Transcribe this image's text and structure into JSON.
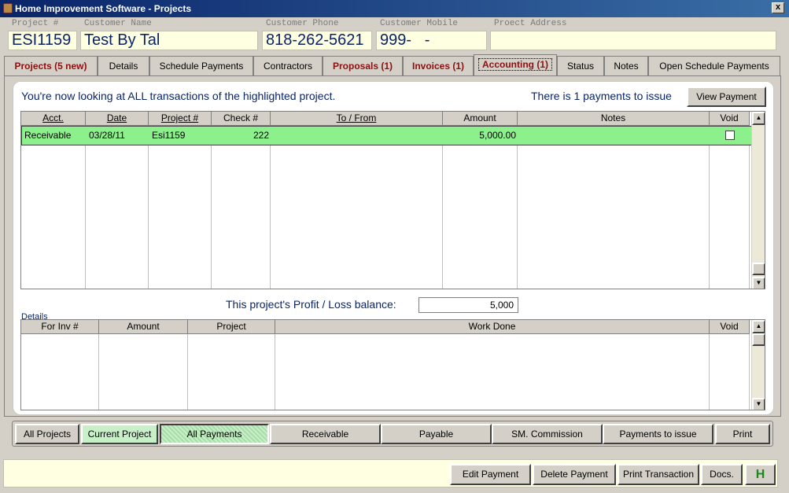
{
  "window": {
    "title": "Home Improvement Software - Projects",
    "close_glyph": "x"
  },
  "header": {
    "project_num": {
      "label": "Project #",
      "value": "ESI1159"
    },
    "customer_name": {
      "label": "Customer Name",
      "value": "Test By Tal"
    },
    "customer_phone": {
      "label": "Customer Phone",
      "value": "818-262-5621"
    },
    "customer_mobile": {
      "label": "Customer Mobile",
      "value": "999-   -"
    },
    "project_address": {
      "label": "Proect Address",
      "value": ""
    }
  },
  "tabs": [
    {
      "label": "Projects (5 new)"
    },
    {
      "label": "Details"
    },
    {
      "label": "Schedule Payments"
    },
    {
      "label": "Contractors"
    },
    {
      "label": "Proposals (1)"
    },
    {
      "label": "Invoices (1)"
    },
    {
      "label": "Accounting (1)"
    },
    {
      "label": "Status"
    },
    {
      "label": "Notes"
    },
    {
      "label": "Open Schedule Payments"
    }
  ],
  "accounting": {
    "headline": "You're now looking at ALL transactions of the highlighted project.",
    "issue_text": "There is 1 payments to issue",
    "view_payment_label": "View Payment",
    "transactions": {
      "columns": [
        "Acct.",
        "Date",
        "Project #",
        "Check #",
        "To / From",
        "Amount",
        "Notes",
        "Void"
      ],
      "rows": [
        {
          "acct": "Receivable",
          "date": "03/28/11",
          "project": "Esi1159",
          "check": "222",
          "to_from": "",
          "amount": "5,000.00",
          "notes": "",
          "void": false
        }
      ]
    },
    "balance_label": "This project's Profit / Loss balance:",
    "balance_value": "5,000",
    "details_label": "Details",
    "details": {
      "columns": [
        "For Inv #",
        "Amount",
        "Project",
        "Work Done",
        "Void"
      ],
      "rows": []
    }
  },
  "filter_buttons": {
    "all_projects": "All Projects",
    "current_project": "Current Project",
    "all_payments": "All Payments",
    "receivable": "Receivable",
    "payable": "Payable",
    "sm_commission": "SM. Commission",
    "payments_to_issue": "Payments to issue",
    "print": "Print"
  },
  "status_buttons": {
    "edit_payment": "Edit Payment",
    "delete_payment": "Delete Payment",
    "print_transaction": "Print Transaction",
    "docs": "Docs.",
    "help": "H"
  },
  "scrollbar_glyphs": {
    "up": "▲",
    "down": "▼"
  }
}
